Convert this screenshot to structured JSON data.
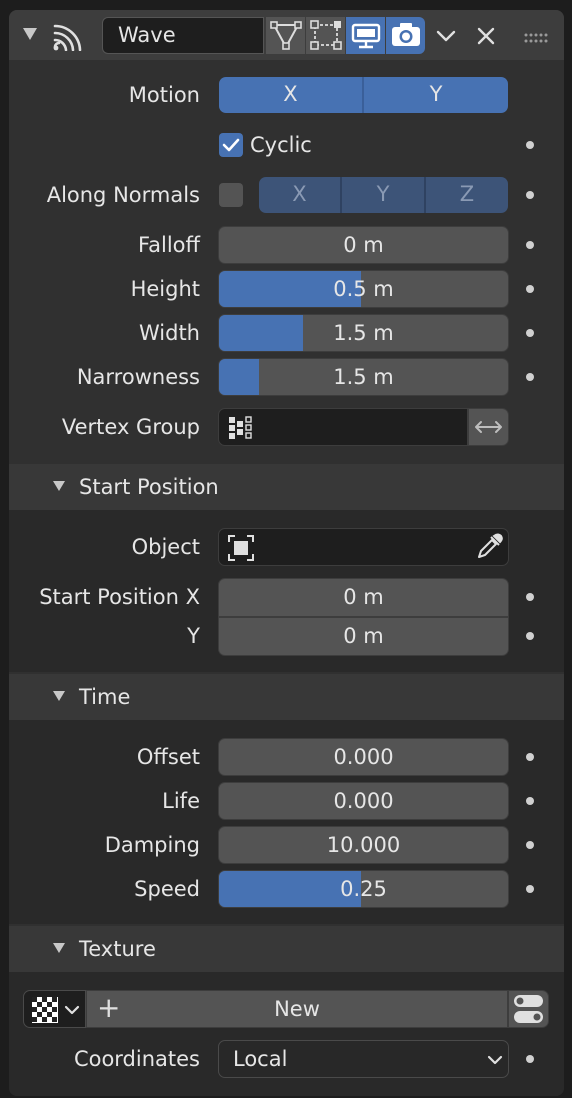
{
  "header": {
    "name_value": "Wave",
    "icons": [
      "wave-modifier-icon",
      "edit-mode-icon",
      "cage-icon",
      "realtime-display-icon",
      "render-camera-icon",
      "chevron-down-icon",
      "close-icon",
      "drag-handle-icon"
    ]
  },
  "motion": {
    "label": "Motion",
    "x": "X",
    "y": "Y"
  },
  "cyclic": {
    "label": "Cyclic",
    "checked": true
  },
  "along_normals": {
    "label": "Along Normals",
    "checked": false,
    "x": "X",
    "y": "Y",
    "z": "Z"
  },
  "falloff": {
    "label": "Falloff",
    "value": "0 m"
  },
  "height": {
    "label": "Height",
    "value": "0.5 m",
    "fill": 0.49
  },
  "width": {
    "label": "Width",
    "value": "1.5 m",
    "fill": 0.29
  },
  "narrowness": {
    "label": "Narrowness",
    "value": "1.5 m",
    "fill": 0.14
  },
  "vertex_group": {
    "label": "Vertex Group",
    "value": ""
  },
  "start_position": {
    "title": "Start Position",
    "object_label": "Object",
    "object_value": "",
    "x_label": "Start Position X",
    "x_value": "0 m",
    "y_label": "Y",
    "y_value": "0 m"
  },
  "time": {
    "title": "Time",
    "offset_label": "Offset",
    "offset_value": "0.000",
    "life_label": "Life",
    "life_value": "0.000",
    "damping_label": "Damping",
    "damping_value": "10.000",
    "speed_label": "Speed",
    "speed_value": "0.25",
    "speed_fill": 0.49
  },
  "texture": {
    "title": "Texture",
    "new_label": "New",
    "plus": "+",
    "coordinates_label": "Coordinates",
    "coordinates_value": "Local"
  },
  "colors": {
    "accent": "#4772b3",
    "field": "#545454",
    "panel": "#303030",
    "section": "#292929"
  }
}
